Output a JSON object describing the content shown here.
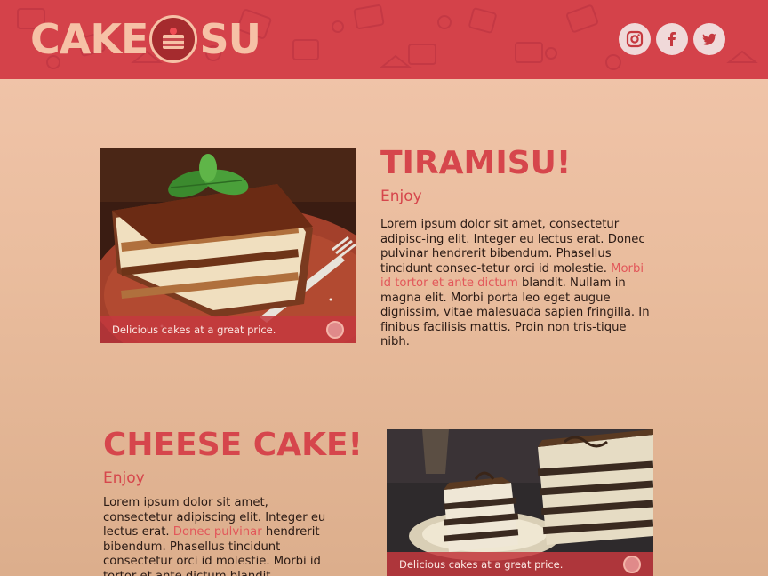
{
  "brand": {
    "logo_left": "CAKE",
    "logo_right": "SU"
  },
  "social": [
    {
      "icon": "instagram-icon"
    },
    {
      "icon": "facebook-icon"
    },
    {
      "icon": "twitter-icon"
    }
  ],
  "section1": {
    "title": "TIRAMISU!",
    "subtitle": "Enjoy",
    "text_before": "Lorem ipsum dolor sit amet, consectetur adipisc-ing elit. Integer eu lectus erat. Donec pulvinar hendrerit bibendum. Phasellus tincidunt consec-tetur orci id molestie. ",
    "link": "Morbi id tortor et ante dictum",
    "text_after": " blandit. Nullam in magna elit. Morbi porta leo eget augue dignissim, vitae malesuada sapien fringilla. In finibus facilisis mattis. Proin non tris-tique nibh.",
    "caption": "Delicious cakes at a great price."
  },
  "section2": {
    "title": "CHEESE CAKE!",
    "subtitle": "Enjoy",
    "text_before": "Lorem ipsum dolor sit amet, consectetur adipiscing elit. Integer eu lectus erat. ",
    "link": "Donec pulvinar",
    "text_after": " hendrerit bibendum. Phasellus tincidunt consectetur orci id molestie. Morbi id tortor et ante dictum blandit.",
    "caption": "Delicious cakes at a great price."
  },
  "colors": {
    "header": "#d4424a",
    "accent": "#d6464c",
    "logo": "#f6c1a6"
  }
}
